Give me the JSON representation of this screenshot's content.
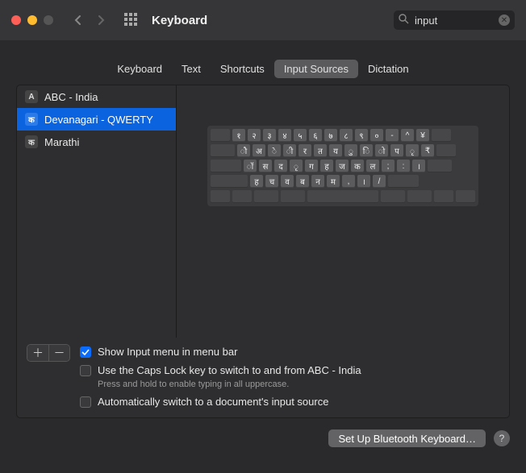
{
  "window": {
    "title": "Keyboard"
  },
  "search": {
    "value": "input"
  },
  "tabs": {
    "items": [
      {
        "label": "Keyboard"
      },
      {
        "label": "Text"
      },
      {
        "label": "Shortcuts"
      },
      {
        "label": "Input Sources"
      },
      {
        "label": "Dictation"
      }
    ],
    "active_index": 3
  },
  "sources": [
    {
      "icon": "A",
      "label": "ABC - India"
    },
    {
      "icon": "क",
      "label": "Devanagari - QWERTY"
    },
    {
      "icon": "क",
      "label": "Marathi"
    }
  ],
  "selected_source_index": 1,
  "keyboard_rows": [
    [
      "१",
      "२",
      "३",
      "४",
      "५",
      "६",
      "७",
      "८",
      "९",
      "०",
      "-",
      "^",
      "¥"
    ],
    [
      "ौ",
      "अ",
      "े",
      "ी",
      "र",
      "त",
      "य",
      "ु",
      "ि",
      "ो",
      "प",
      "ृ",
      "₹"
    ],
    [
      "ॉ",
      "स",
      "द",
      "ृ",
      "ग",
      "ह",
      "ज",
      "क",
      "ल",
      ";",
      ":",
      "।"
    ],
    [
      "ह",
      "च",
      "व",
      "ब",
      "न",
      "म",
      ",",
      "।",
      "/"
    ]
  ],
  "options": {
    "show_menu": {
      "label": "Show Input menu in menu bar",
      "checked": true
    },
    "caps_lock": {
      "label": "Use the Caps Lock key to switch to and from ABC - India",
      "checked": false,
      "help": "Press and hold to enable typing in all uppercase."
    },
    "auto_switch": {
      "label": "Automatically switch to a document's input source",
      "checked": false
    }
  },
  "buttons": {
    "bluetooth": "Set Up Bluetooth Keyboard…"
  }
}
